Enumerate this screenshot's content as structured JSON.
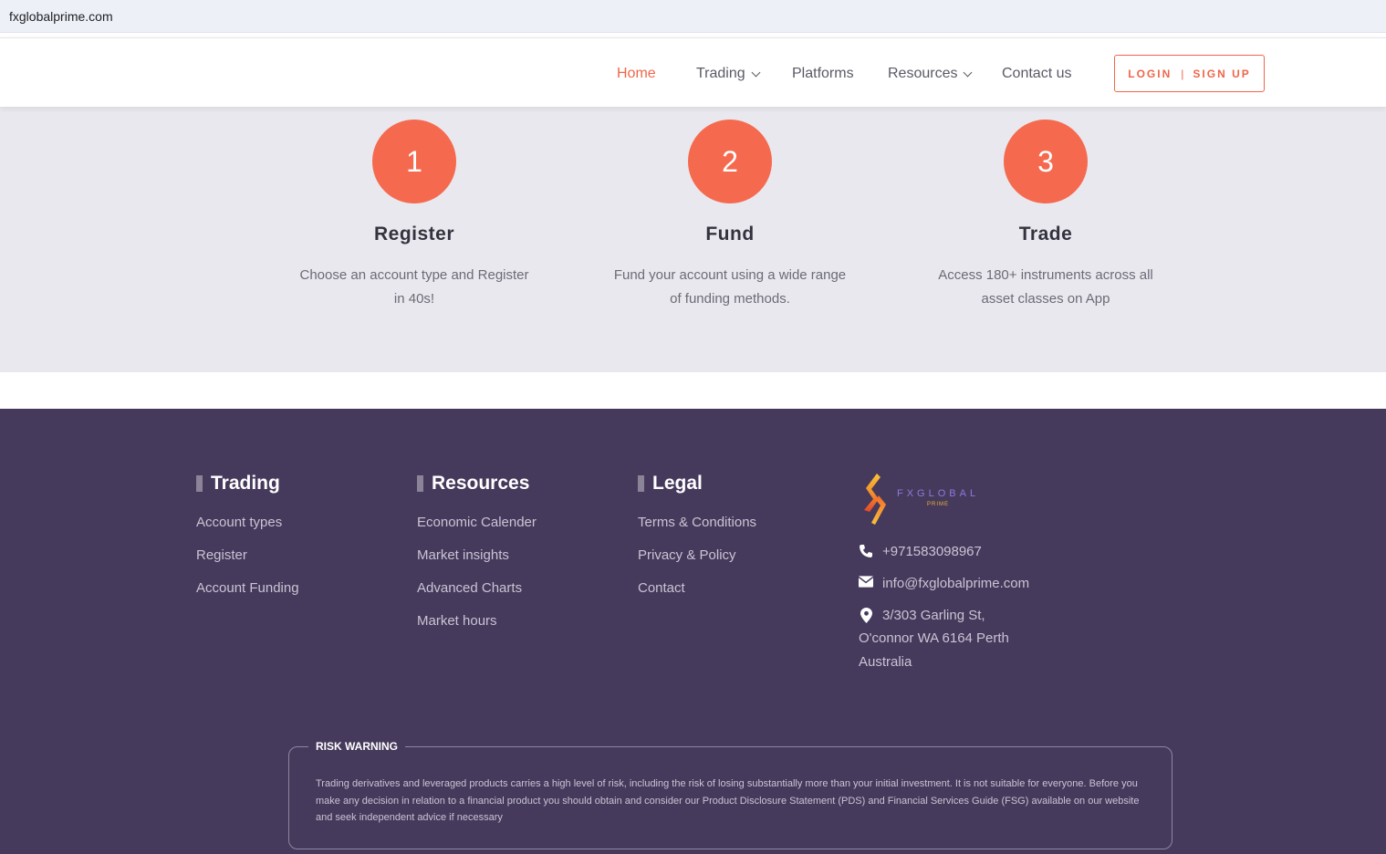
{
  "browser": {
    "url": "fxglobalprime.com"
  },
  "nav": {
    "items": [
      {
        "label": "Home",
        "active": true,
        "dropdown": false
      },
      {
        "label": "Trading",
        "active": false,
        "dropdown": true
      },
      {
        "label": "Platforms",
        "active": false,
        "dropdown": false
      },
      {
        "label": "Resources",
        "active": false,
        "dropdown": true
      },
      {
        "label": "Contact us",
        "active": false,
        "dropdown": false
      }
    ],
    "login_label": "LOGIN",
    "separator": "|",
    "signup_label": "SIGN UP"
  },
  "steps": [
    {
      "number": "1",
      "title": "Register",
      "desc_line1": "Choose an account type and Register",
      "desc_line2": "in 40s!"
    },
    {
      "number": "2",
      "title": "Fund",
      "desc_line1": "Fund your account using a wide range",
      "desc_line2": "of funding methods."
    },
    {
      "number": "3",
      "title": "Trade",
      "desc_line1": "Access 180+ instruments across all",
      "desc_line2": "asset classes on App"
    }
  ],
  "footer": {
    "columns": [
      {
        "heading": "Trading",
        "links": [
          "Account types",
          "Register",
          "Account Funding"
        ]
      },
      {
        "heading": "Resources",
        "links": [
          "Economic Calender",
          "Market insights",
          "Advanced Charts",
          "Market hours"
        ]
      },
      {
        "heading": "Legal",
        "links": [
          "Terms & Conditions",
          "Privacy & Policy",
          "Contact"
        ]
      }
    ],
    "brand": {
      "name": "FXGLOBAL",
      "sub": "PRIME"
    },
    "contact": {
      "phone": "+971583098967",
      "email": "info@fxglobalprime.com",
      "address_line1": "3/303 Garling St,",
      "address_line2": "O'connor WA 6164 Perth",
      "address_line3": "Australia"
    },
    "risk": {
      "label": "RISK WARNING",
      "text": "Trading derivatives and leveraged products carries a high level of risk, including the risk of losing substantially more than your initial investment. It is not suitable for everyone. Before you make any decision in relation to a financial product you should obtain and consider our Product Disclosure Statement (PDS) and Financial Services Guide (FSG) available on our website and seek independent advice if necessary"
    }
  },
  "colors": {
    "accent": "#f56a4f",
    "footer_bg": "#463a5c",
    "steps_bg": "#e9e8ee"
  }
}
